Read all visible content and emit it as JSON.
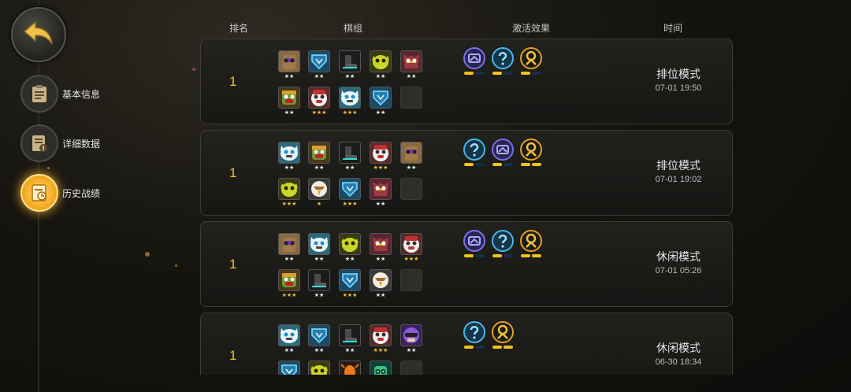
{
  "sidebar": {
    "back": "back-arrow-icon",
    "items": [
      {
        "label": "基本信息",
        "icon": "clipboard-icon",
        "active": false
      },
      {
        "label": "详细数据",
        "icon": "data-sheet-icon",
        "active": false
      },
      {
        "label": "历史战绩",
        "icon": "history-icon",
        "active": true
      }
    ]
  },
  "table": {
    "headers": {
      "rank": "排名",
      "lineup": "棋组",
      "effects": "激活效果",
      "time": "时间"
    },
    "rows": [
      {
        "rank": "1",
        "mode": "排位模式",
        "time": "07-01 19:50",
        "pieces": [
          {
            "type": "lion",
            "stars": 2,
            "gold": false
          },
          {
            "type": "shield",
            "stars": 2,
            "gold": false
          },
          {
            "type": "boot",
            "stars": 2,
            "gold": false
          },
          {
            "type": "yellow-goblin",
            "stars": 2,
            "gold": false
          },
          {
            "type": "red-beast",
            "stars": 2,
            "gold": false
          },
          {
            "type": "troll",
            "stars": 2,
            "gold": false
          },
          {
            "type": "bear",
            "stars": 3,
            "gold": true
          },
          {
            "type": "yeti",
            "stars": 3,
            "gold": true
          },
          {
            "type": "shield",
            "stars": 2,
            "gold": false
          },
          {
            "type": "empty",
            "stars": 0,
            "gold": false
          }
        ],
        "effects": [
          {
            "type": "mech",
            "bars": [
              1,
              0
            ]
          },
          {
            "type": "mage",
            "bars": [
              1,
              0
            ]
          },
          {
            "type": "warrior",
            "bars": [
              1,
              0
            ]
          }
        ]
      },
      {
        "rank": "1",
        "mode": "排位模式",
        "time": "07-01 19:02",
        "pieces": [
          {
            "type": "yeti",
            "stars": 2,
            "gold": false
          },
          {
            "type": "troll",
            "stars": 2,
            "gold": false
          },
          {
            "type": "boot",
            "stars": 2,
            "gold": false
          },
          {
            "type": "bear",
            "stars": 3,
            "gold": true
          },
          {
            "type": "lion",
            "stars": 2,
            "gold": false
          },
          {
            "type": "yellow-goblin",
            "stars": 3,
            "gold": true
          },
          {
            "type": "eagle",
            "stars": 1,
            "gold": true
          },
          {
            "type": "shield",
            "stars": 3,
            "gold": true
          },
          {
            "type": "red-beast",
            "stars": 2,
            "gold": false
          },
          {
            "type": "empty",
            "stars": 0,
            "gold": false
          }
        ],
        "effects": [
          {
            "type": "mage",
            "bars": [
              1,
              0
            ]
          },
          {
            "type": "mech",
            "bars": [
              1,
              0
            ]
          },
          {
            "type": "warrior",
            "bars": [
              1,
              1
            ]
          }
        ]
      },
      {
        "rank": "1",
        "mode": "休闲模式",
        "time": "07-01 05:26",
        "pieces": [
          {
            "type": "lion",
            "stars": 2,
            "gold": false
          },
          {
            "type": "yeti",
            "stars": 2,
            "gold": false
          },
          {
            "type": "yellow-goblin",
            "stars": 2,
            "gold": false
          },
          {
            "type": "red-beast",
            "stars": 2,
            "gold": false
          },
          {
            "type": "bear",
            "stars": 3,
            "gold": true
          },
          {
            "type": "troll",
            "stars": 3,
            "gold": true
          },
          {
            "type": "boot",
            "stars": 2,
            "gold": false
          },
          {
            "type": "shield",
            "stars": 3,
            "gold": true
          },
          {
            "type": "eagle",
            "stars": 2,
            "gold": false
          },
          {
            "type": "empty",
            "stars": 0,
            "gold": false
          }
        ],
        "effects": [
          {
            "type": "mech",
            "bars": [
              1,
              0
            ]
          },
          {
            "type": "mage",
            "bars": [
              1,
              0
            ]
          },
          {
            "type": "warrior",
            "bars": [
              1,
              1
            ]
          }
        ]
      },
      {
        "rank": "1",
        "mode": "休闲模式",
        "time": "06-30 18:34",
        "pieces": [
          {
            "type": "yeti",
            "stars": 2,
            "gold": false
          },
          {
            "type": "shield",
            "stars": 2,
            "gold": false
          },
          {
            "type": "boot",
            "stars": 2,
            "gold": false
          },
          {
            "type": "bear",
            "stars": 3,
            "gold": true
          },
          {
            "type": "purple-rogue",
            "stars": 2,
            "gold": false
          },
          {
            "type": "shield",
            "stars": 0,
            "gold": false
          },
          {
            "type": "yellow-goblin",
            "stars": 0,
            "gold": false
          },
          {
            "type": "orange-spider",
            "stars": 0,
            "gold": false
          },
          {
            "type": "green-robot",
            "stars": 0,
            "gold": false
          },
          {
            "type": "empty",
            "stars": 0,
            "gold": false
          }
        ],
        "effects": [
          {
            "type": "mage",
            "bars": [
              1,
              0
            ]
          },
          {
            "type": "warrior",
            "bars": [
              1,
              1
            ]
          }
        ]
      }
    ]
  },
  "colors": {
    "accent": "#f0c030",
    "bar_on": "#f2c21e",
    "bar_off": "#1a2e44",
    "mech": "#6a5fd8",
    "mage": "#38a8d8",
    "warrior": "#e2a020"
  }
}
